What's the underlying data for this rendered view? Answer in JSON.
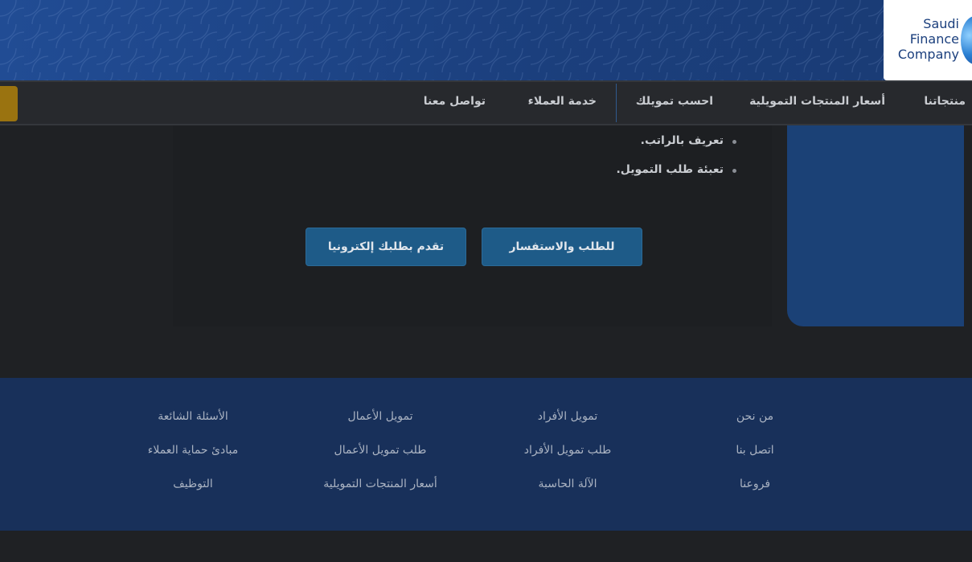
{
  "logo": {
    "line1": "Saudi",
    "line2": "Finance",
    "line3": "Company"
  },
  "nav": {
    "items": [
      "منتجاتنا",
      "أسعار المنتجات التمويلية",
      "احسب تمويلك",
      "خدمة العملاء",
      "تواصل معنا"
    ]
  },
  "main": {
    "bullets": [
      "تعريف بالراتب.",
      "تعبئة طلب التمويل."
    ],
    "buttons": {
      "inquiry": "للطلب والاستفسار",
      "apply_online": "تقدم بطلبك إلكترونيا"
    }
  },
  "footer": {
    "columns": [
      [
        "من نحن",
        "اتصل بنا",
        "فروعنا"
      ],
      [
        "تمويل الأفراد",
        "طلب تمويل الأفراد",
        "الآلة الحاسبة"
      ],
      [
        "تمويل الأعمال",
        "طلب تمويل الأعمال",
        "أسعار المنتجات التمويلية"
      ],
      [
        "الأسئلة الشائعة",
        "مبادئ حماية العملاء",
        "التوظيف"
      ]
    ]
  },
  "colors": {
    "banner": "#1d4486",
    "navbar": "#27292d",
    "accent_gold": "#9a7310",
    "button": "#1e5b88",
    "footer": "#18305a"
  }
}
